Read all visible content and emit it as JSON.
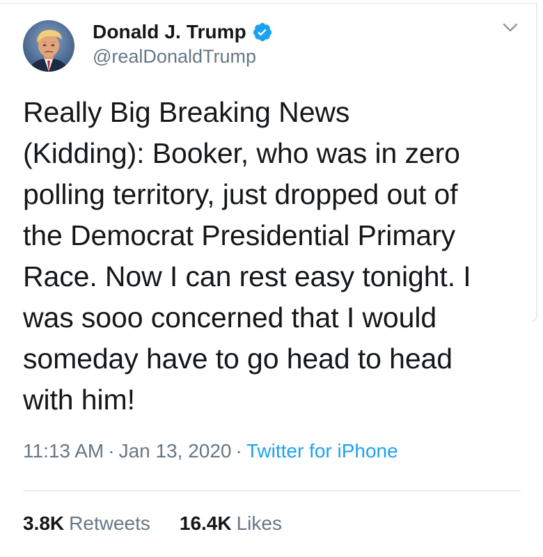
{
  "tweet": {
    "author": {
      "display_name": "Donald J. Trump",
      "handle": "@realDonaldTrump",
      "verified": true,
      "avatar_icon": "profile-photo"
    },
    "menu_icon": "chevron-down-icon",
    "text_lines": [
      "Really Big Breaking News",
      "(Kidding): Booker, who was in zero",
      "polling territory, just dropped out of",
      "the Democrat Presidential Primary",
      "Race. Now I can rest easy tonight. I",
      "was sooo concerned that I would",
      "someday have to go head to head",
      "with him!"
    ],
    "time": "11:13 AM",
    "date": "Jan 13, 2020",
    "separator": "·",
    "source": "Twitter for iPhone",
    "stats": {
      "retweets_count": "3.8K",
      "retweets_label": "Retweets",
      "likes_count": "16.4K",
      "likes_label": "Likes"
    }
  },
  "colors": {
    "text_primary": "#14171a",
    "text_secondary": "#657786",
    "accent_blue": "#1da1f2",
    "divider": "#e6ecf0"
  }
}
